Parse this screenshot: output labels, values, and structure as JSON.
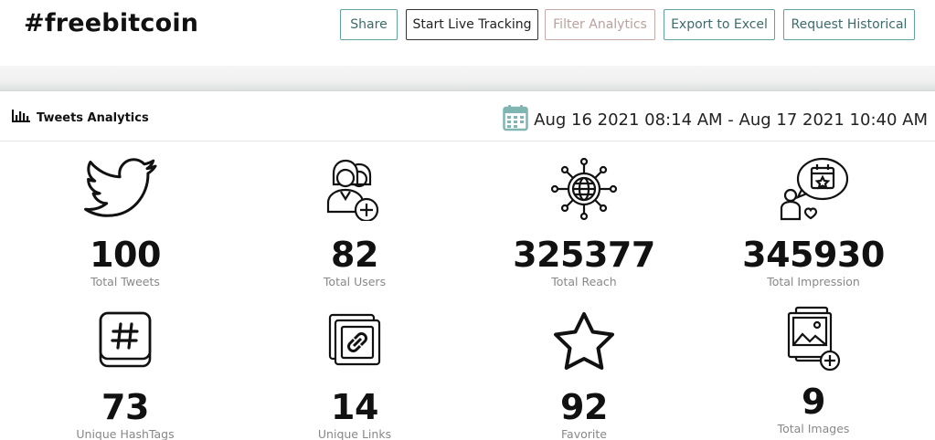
{
  "header": {
    "title": "#freebitcoin",
    "buttons": {
      "share": "Share",
      "live_tracking": "Start Live Tracking",
      "filter": "Filter Analytics",
      "export": "Export to Excel",
      "historical": "Request Historical"
    }
  },
  "card": {
    "title": "Tweets Analytics",
    "title_icon": "bar-chart-icon",
    "date_icon": "calendar-icon",
    "date_range": "Aug 16 2021 08:14 AM - Aug 17 2021 10:40 AM"
  },
  "stats": [
    {
      "icon": "twitter-bird-icon",
      "value": "100",
      "label": "Total Tweets"
    },
    {
      "icon": "users-add-icon",
      "value": "82",
      "label": "Total Users"
    },
    {
      "icon": "network-globe-icon",
      "value": "325377",
      "label": "Total Reach"
    },
    {
      "icon": "impression-person-icon",
      "value": "345930",
      "label": "Total Impression"
    },
    {
      "icon": "hashtag-icon",
      "value": "73",
      "label": "Unique HashTags"
    },
    {
      "icon": "link-icon",
      "value": "14",
      "label": "Unique Links"
    },
    {
      "icon": "star-icon",
      "value": "92",
      "label": "Favorite"
    },
    {
      "icon": "image-add-icon",
      "value": "9",
      "label": "Total Images"
    }
  ],
  "colors": {
    "button_border": "#5fa3a0",
    "button_text": "#3d6b6b",
    "disabled_border": "#c9a9a4",
    "calendar": "#7fb6b2"
  }
}
